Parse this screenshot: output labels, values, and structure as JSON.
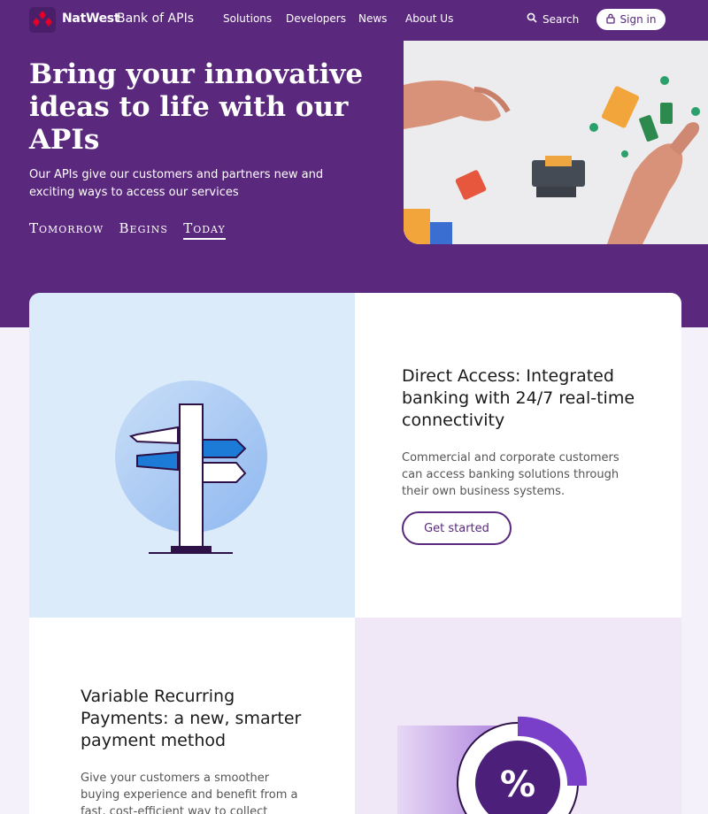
{
  "header": {
    "brand": "NatWest",
    "sub_brand": "Bank of APIs",
    "nav": [
      "Solutions",
      "Developers",
      "News",
      "About Us"
    ],
    "search_label": "Search",
    "signin_label": "Sign in"
  },
  "hero": {
    "title": "Bring your innovative ideas to life with our APIs",
    "description": "Our APIs give our customers and partners new and exciting ways to access our services",
    "tagline": {
      "part1": "Tomorrow",
      "part2": "Begins",
      "part3": "Today"
    },
    "image_icon": "lego-bricks-photo"
  },
  "cards": [
    {
      "title": "Direct Access: Integrated banking with 24/7 real-time connectivity",
      "description": "Commercial and corporate customers can access banking solutions through their own business systems.",
      "button": "Get started",
      "icon": "signpost-illustration"
    },
    {
      "title": "Variable Recurring Payments: a new, smarter payment method",
      "description": "Give your customers a smoother buying experience and benefit from a fast, cost-efficient way to collect",
      "icon": "percent-dial-illustration"
    }
  ],
  "colors": {
    "brand_purple": "#5a287d",
    "accent_red": "#e60028",
    "accent_blue": "#1d7bd8"
  }
}
